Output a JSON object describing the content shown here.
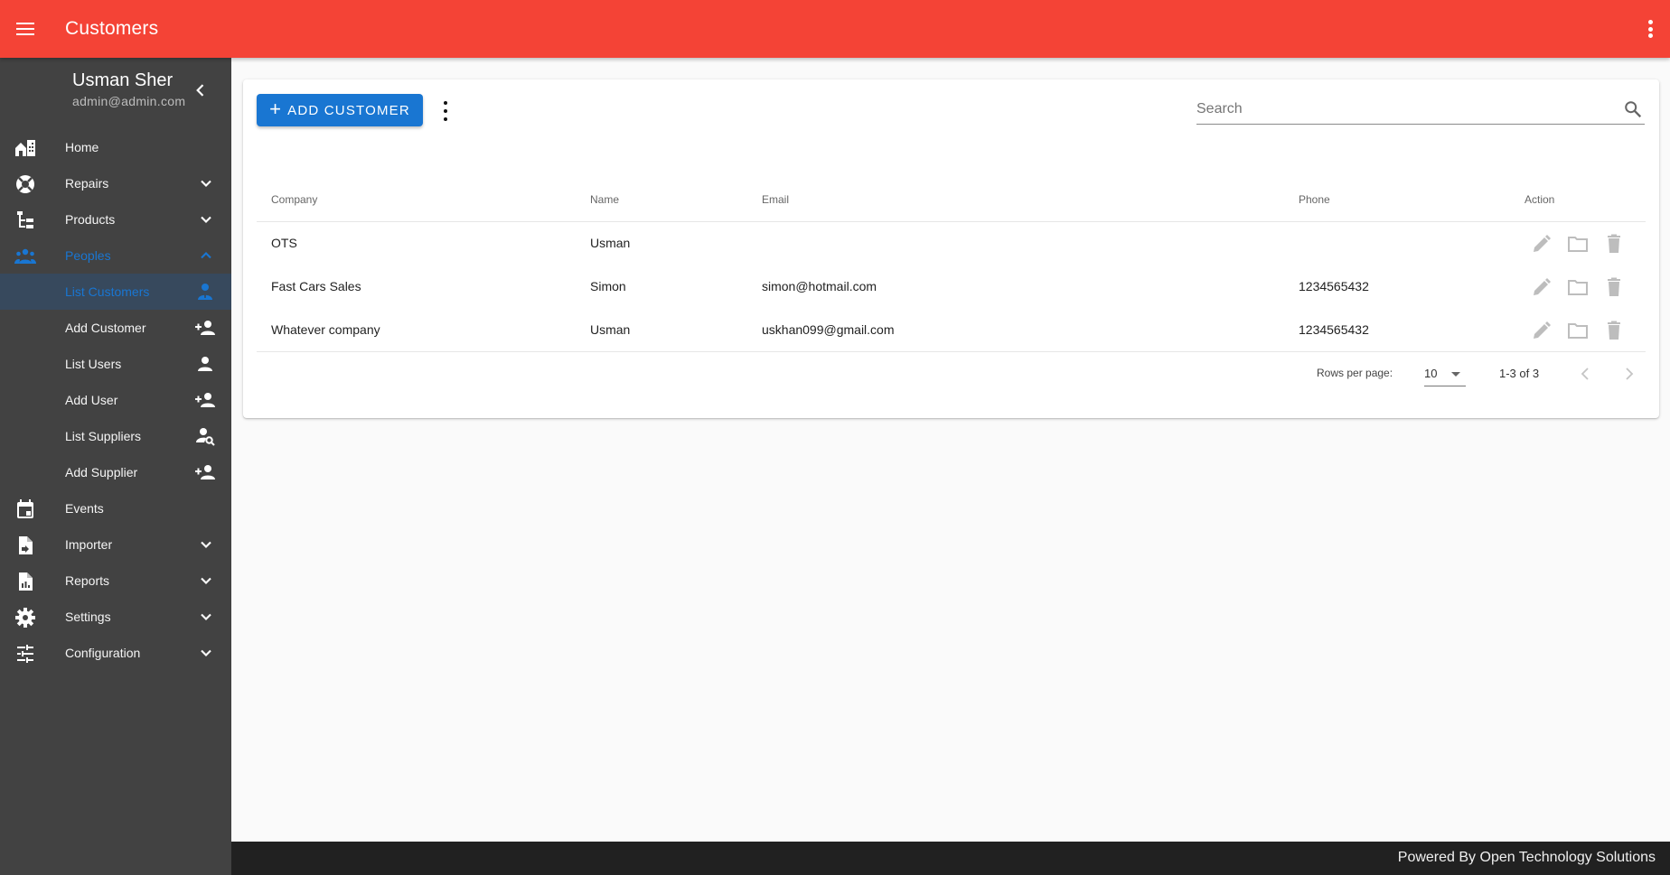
{
  "appbar": {
    "title": "Customers",
    "menu_icon": "hamburger-menu-icon",
    "more_icon": "more-vertical-icon",
    "color": "#f44336"
  },
  "sidebar": {
    "user_name": "Usman Sher",
    "user_email": "admin@admin.com",
    "collapse_icon": "chevron-left-icon",
    "items": [
      {
        "label": "Home",
        "icon": "home-city-icon",
        "expandable": false
      },
      {
        "label": "Repairs",
        "icon": "lifebuoy-icon",
        "expandable": true,
        "expanded": false
      },
      {
        "label": "Products",
        "icon": "file-tree-icon",
        "expandable": true,
        "expanded": false
      },
      {
        "label": "Peoples",
        "icon": "people-icon",
        "expandable": true,
        "expanded": true,
        "active": true
      },
      {
        "label": "List Customers",
        "icon": "person-tie-icon",
        "sub": true,
        "selected": true
      },
      {
        "label": "Add Customer",
        "icon": "person-add-icon",
        "sub": true
      },
      {
        "label": "List Users",
        "icon": "person-icon",
        "sub": true
      },
      {
        "label": "Add User",
        "icon": "person-add-icon",
        "sub": true
      },
      {
        "label": "List Suppliers",
        "icon": "person-search-icon",
        "sub": true
      },
      {
        "label": "Add Supplier",
        "icon": "person-add-icon",
        "sub": true
      },
      {
        "label": "Events",
        "icon": "calendar-icon",
        "expandable": false
      },
      {
        "label": "Importer",
        "icon": "file-import-icon",
        "expandable": true,
        "expanded": false
      },
      {
        "label": "Reports",
        "icon": "file-chart-icon",
        "expandable": true,
        "expanded": false
      },
      {
        "label": "Settings",
        "icon": "gear-icon",
        "expandable": true,
        "expanded": false
      },
      {
        "label": "Configuration",
        "icon": "tune-icon",
        "expandable": true,
        "expanded": false
      }
    ],
    "active_color": "#1976d2"
  },
  "toolbar": {
    "add_label": "ADD CUSTOMER",
    "add_icon": "plus-icon",
    "search_placeholder": "Search",
    "search_value": ""
  },
  "table": {
    "columns": [
      "Company",
      "Name",
      "Email",
      "Phone",
      "Action"
    ],
    "rows": [
      {
        "company": "OTS",
        "name": "Usman",
        "email": "",
        "phone": ""
      },
      {
        "company": "Fast Cars Sales",
        "name": "Simon",
        "email": "simon@hotmail.com",
        "phone": "1234565432"
      },
      {
        "company": "Whatever company",
        "name": "Usman",
        "email": "uskhan099@gmail.com",
        "phone": "1234565432"
      }
    ],
    "row_actions": [
      "edit-icon",
      "folder-icon",
      "delete-icon"
    ]
  },
  "pagination": {
    "rows_per_page_label": "Rows per page:",
    "rows_per_page": "10",
    "range": "1-3 of 3"
  },
  "footer": {
    "text": "Powered By Open Technology Solutions"
  }
}
